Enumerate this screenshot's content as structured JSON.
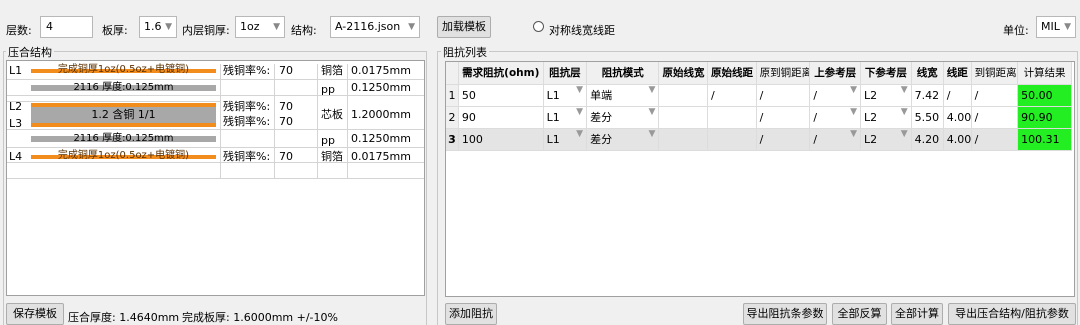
{
  "toolbar": {
    "layers_label": "层数:",
    "layers_value": "4",
    "thickness_label": "板厚:",
    "thickness_value": "1.6",
    "inner_copper_label": "内层铜厚:",
    "inner_copper_value": "1oz",
    "structure_label": "结构:",
    "structure_value": "A-2116.json",
    "load_template": "加载模板",
    "symmetric_label": "对称线宽线距",
    "unit_label": "单位:",
    "unit_value": "MIL"
  },
  "stackup": {
    "group_title": "压合结构",
    "l1": "L1",
    "l2": "L2",
    "l3": "L3",
    "l4": "L4",
    "top_copper_text": "完成铜厚1oz(0.5oz+电镀铜)",
    "pp1_text": "2116 厚度:0.125mm",
    "core_text": "1.2 含铜 1/1",
    "pp2_text": "2116 厚度:0.125mm",
    "bottom_copper_text": "完成铜厚1oz(0.5oz+电镀铜)",
    "residual_label": "残铜率%:",
    "r1": "70",
    "r2": "70",
    "r3": "70",
    "r4": "70",
    "type_foil": "铜箔",
    "type_pp": "pp",
    "type_core": "芯板",
    "t1": "0.0175mm",
    "t2": "0.1250mm",
    "t3": "1.2000mm",
    "t4": "0.1250mm",
    "t5": "0.0175mm",
    "save_template": "保存模板",
    "press_thickness": "压合厚度:  1.4640mm",
    "finish_thickness": "完成板厚:  1.6000mm +/-10%"
  },
  "impedance": {
    "group_title": "阻抗列表",
    "headers": [
      "需求阻抗(ohm)",
      "阻抗层",
      "阻抗模式",
      "原始线宽",
      "原始线距",
      "原到铜距离",
      "上参考层",
      "下参考层",
      "线宽",
      "线距",
      "到铜距离",
      "计算结果"
    ],
    "rows": [
      {
        "no": "1",
        "target": "50",
        "layer": "L1",
        "mode": "单端",
        "ow": "",
        "os": "/",
        "oc": "/",
        "up": "/",
        "down": "L2",
        "w": "7.42",
        "s": "/",
        "c": "/",
        "result": "50.00"
      },
      {
        "no": "2",
        "target": "90",
        "layer": "L1",
        "mode": "差分",
        "ow": "",
        "os": "",
        "oc": "/",
        "up": "/",
        "down": "L2",
        "w": "5.50",
        "s": "4.00",
        "c": "/",
        "result": "90.90"
      },
      {
        "no": "3",
        "target": "100",
        "layer": "L1",
        "mode": "差分",
        "ow": "",
        "os": "",
        "oc": "/",
        "up": "/",
        "down": "L2",
        "w": "4.20",
        "s": "4.00",
        "c": "/",
        "result": "100.31"
      }
    ],
    "add": "添加阻抗",
    "export_bars": "导出阻抗条参数",
    "reverse_all": "全部反算",
    "calc_all": "全部计算",
    "export_all": "导出压合结构/阻抗参数"
  },
  "colors": {
    "copper": "#f28c1c",
    "dielectric": "#a8a8a8",
    "result_ok": "#22ee22"
  }
}
